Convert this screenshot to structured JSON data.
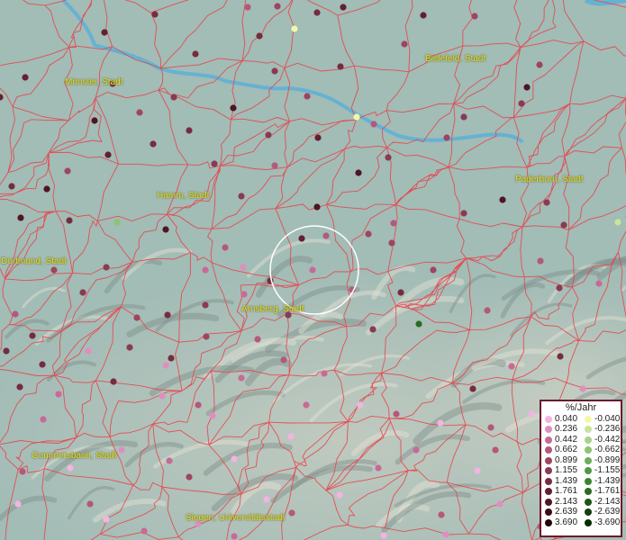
{
  "colors": {
    "boundary": "#e8434a",
    "river": "#5ab0d8",
    "city_label": "#e8e800",
    "legend_border": "#6b1a2d"
  },
  "cities": [
    {
      "name": "Münster, Stadt"
    },
    {
      "name": "Bielefeld, Stadt"
    },
    {
      "name": "Hamm, Stadt"
    },
    {
      "name": "Paderborn, Stadt"
    },
    {
      "name": "Dortmund, Stadt"
    },
    {
      "name": "Arnsberg, Stadt"
    },
    {
      "name": "Gummersbach, Stadt"
    },
    {
      "name": "Siegen, Universitätsstadt"
    }
  ],
  "legend": {
    "title": "%/Jahr",
    "positive": [
      {
        "label": "0.040",
        "color": "#f3b4e0"
      },
      {
        "label": "0.236",
        "color": "#e08ec0"
      },
      {
        "label": "0.442",
        "color": "#c86a98"
      },
      {
        "label": "0.662",
        "color": "#b4587c"
      },
      {
        "label": "0.899",
        "color": "#9e4560"
      },
      {
        "label": "1.155",
        "color": "#8a3a52"
      },
      {
        "label": "1.439",
        "color": "#762c40"
      },
      {
        "label": "1.761",
        "color": "#622032"
      },
      {
        "label": "2.143",
        "color": "#4e1624"
      },
      {
        "label": "2.639",
        "color": "#3a0e18"
      },
      {
        "label": "3.690",
        "color": "#22060c"
      }
    ],
    "negative": [
      {
        "label": "-0.040",
        "color": "#f2f8a8"
      },
      {
        "label": "-0.236",
        "color": "#c8e498"
      },
      {
        "label": "-0.442",
        "color": "#a6d486"
      },
      {
        "label": "-0.662",
        "color": "#8cc470"
      },
      {
        "label": "-0.899",
        "color": "#6eae58"
      },
      {
        "label": "-1.155",
        "color": "#529844"
      },
      {
        "label": "-1.439",
        "color": "#3c8230"
      },
      {
        "label": "-1.761",
        "color": "#2a6c22"
      },
      {
        "label": "-2.143",
        "color": "#1c5616"
      },
      {
        "label": "-2.639",
        "color": "#10400c"
      },
      {
        "label": "-3.690",
        "color": "#062a04"
      }
    ]
  }
}
